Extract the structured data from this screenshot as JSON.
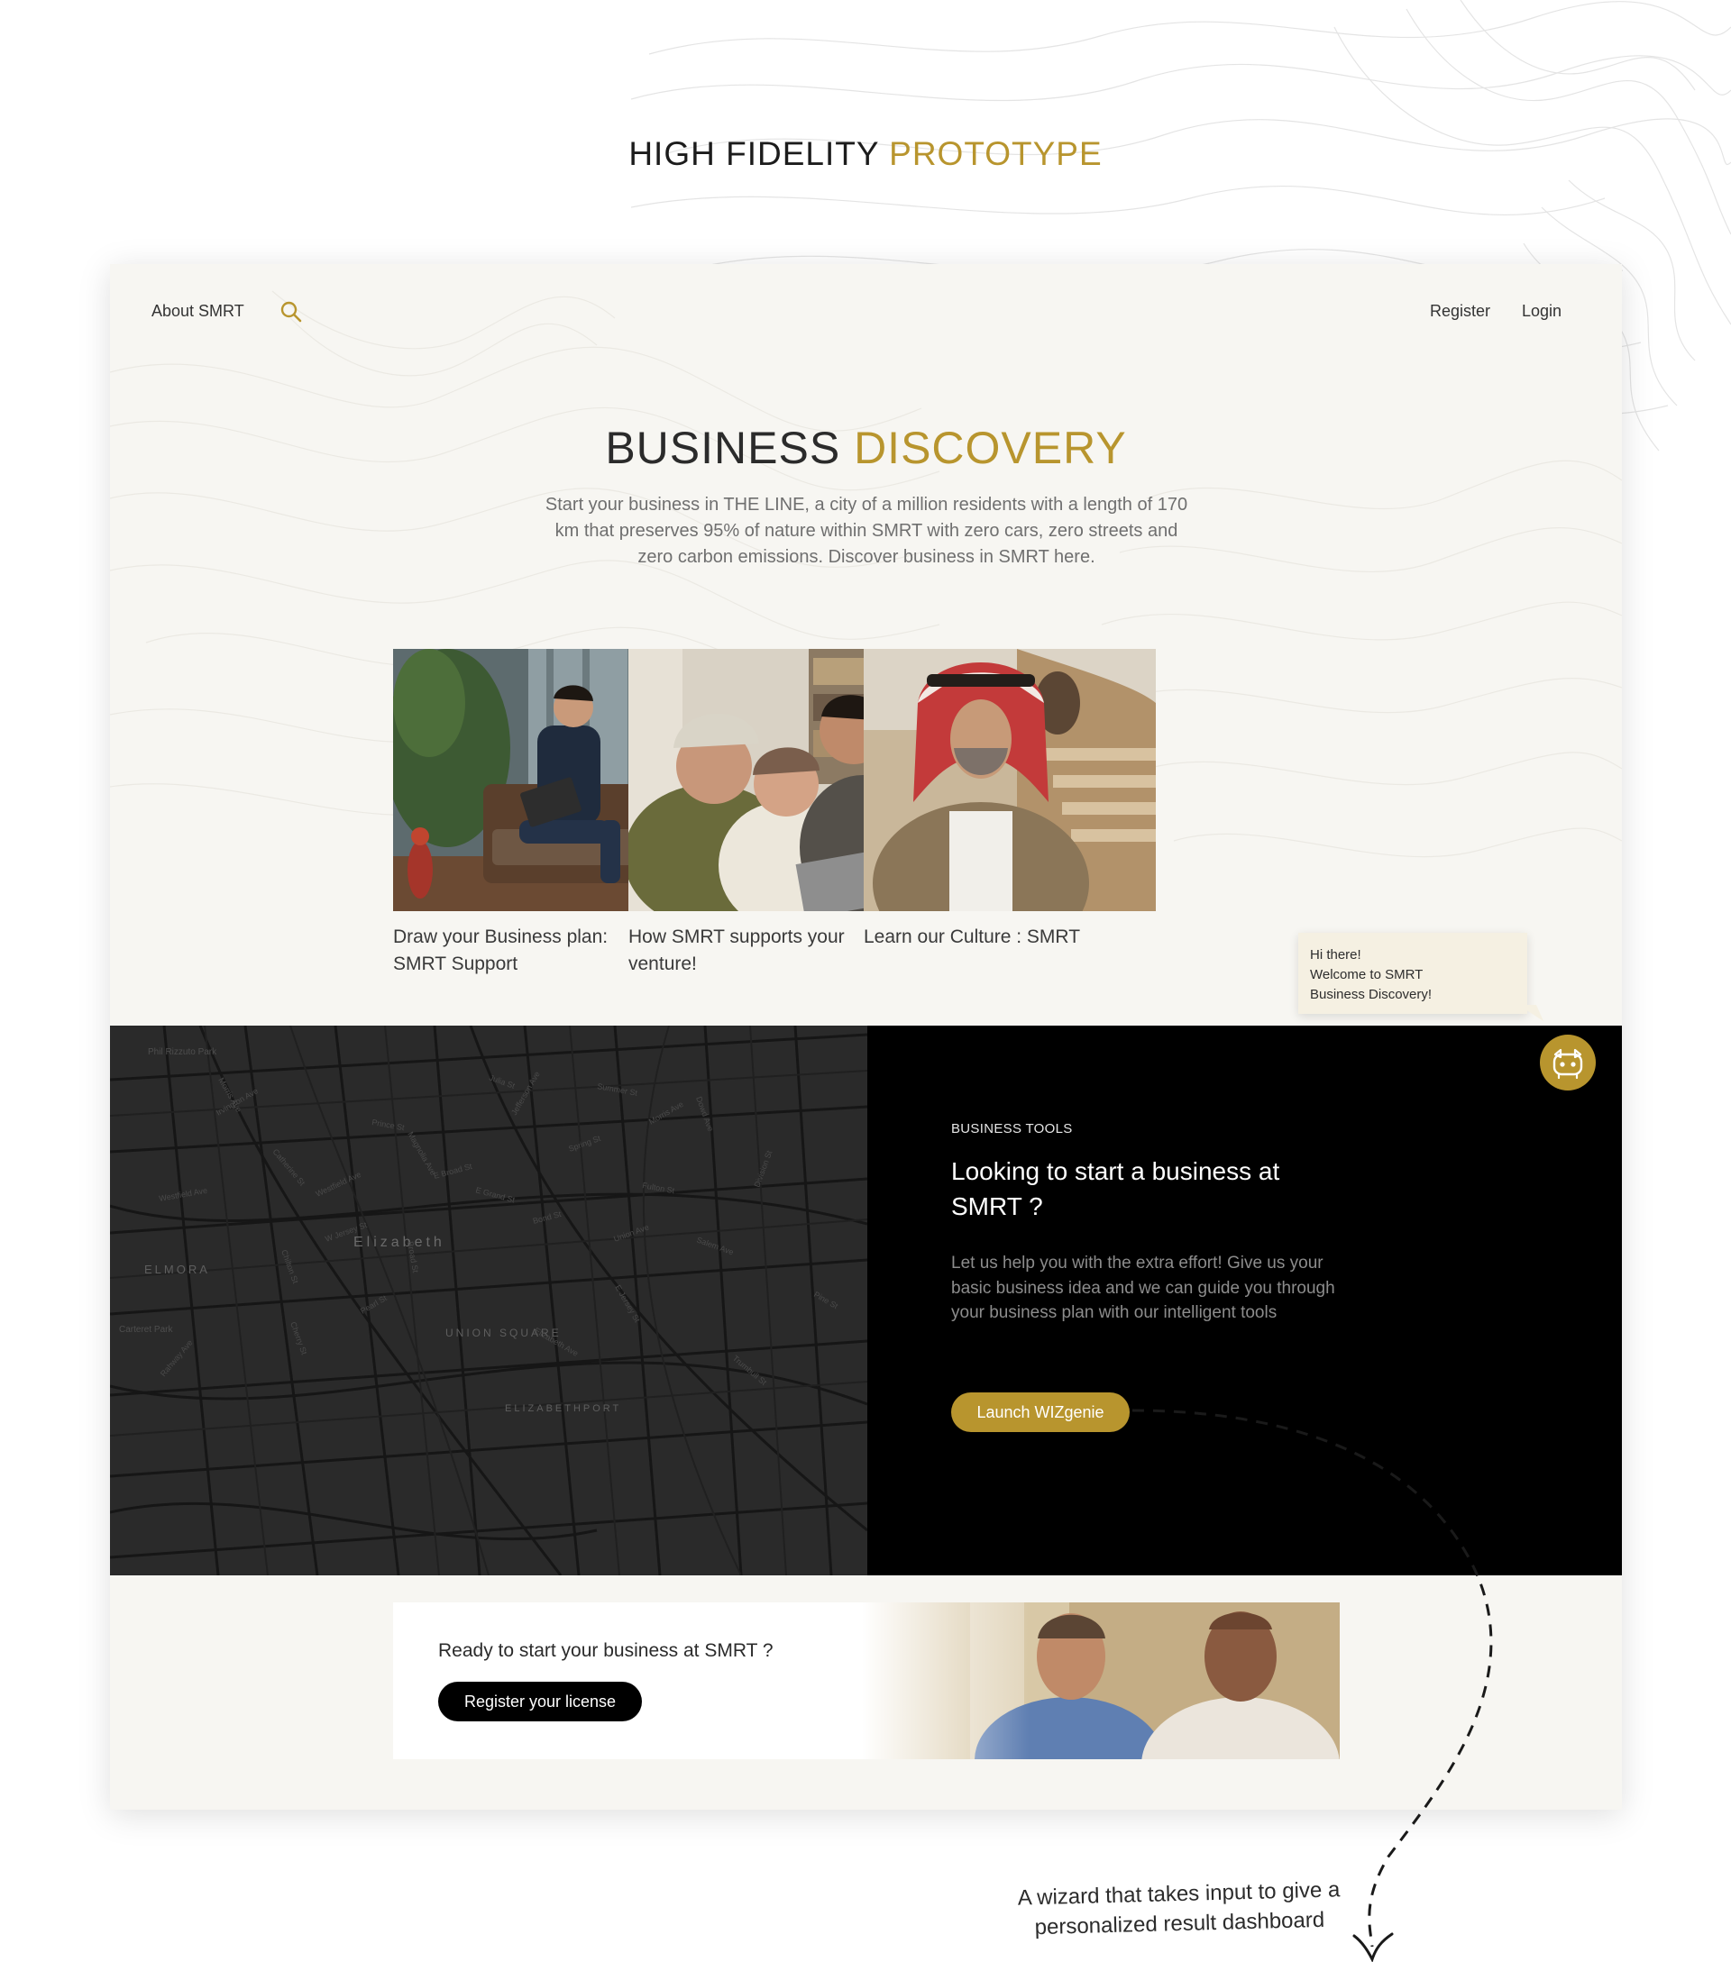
{
  "page": {
    "title_part1": "HIGH FIDELITY",
    "title_part2": "PROTOTYPE",
    "annotation": "A wizard that takes input to give a\npersonalized result dashboard"
  },
  "nav": {
    "about": "About  SMRT",
    "register": "Register",
    "login": "Login"
  },
  "hero": {
    "title_part1": "BUSINESS",
    "title_part2": "DISCOVERY",
    "description": "Start your business in THE LINE, a city of a million residents with a length of 170 km that preserves 95% of nature within  SMRT  with zero cars, zero streets and zero carbon emissions. Discover business in  SMRT  here."
  },
  "cards": [
    {
      "caption": "Draw your Business plan:\n SMRT  Support",
      "image": "man-with-laptop-photo"
    },
    {
      "caption": "How  SMRT  supports your venture!",
      "image": "team-laughing-photo"
    },
    {
      "caption": "Learn our Culture : SMRT",
      "image": "man-in-shemagh-photo"
    }
  ],
  "chat_bubble": {
    "text": "Hi there!\nWelcome to SMRT\nBusiness Discovery!"
  },
  "map": {
    "labels": [
      "Elizabeth",
      "ELMORA",
      "UNION SQUARE",
      "ELIZABETHPORT",
      "Phil Rizzuto Park",
      "Carteret Park",
      "Westfield Ave",
      "E Grand St",
      "W Jersey St",
      "Broad St",
      "Trumbull St",
      "Rahway Ave",
      "Morris Ave",
      "Elizabeth Ave",
      "Dowd Ave",
      "Pearl St",
      "E Jersey St",
      "Prince St",
      "Magnolia Ave",
      "Spring St",
      "Fulton St",
      "Chilton St",
      "Bond St",
      "Jefferson Ave",
      "Julia St",
      "Westfield Ave",
      "Division St",
      "Pine St",
      "E Broad St",
      "Union Ave",
      "Catherine St",
      "Morris Ave",
      "Cherry St",
      "Irvington Ave",
      "Salem Ave",
      "Summer St"
    ]
  },
  "tools": {
    "eyebrow": "BUSINESS TOOLS",
    "title": "Looking to start a business at  SMRT  ?",
    "description": "Let us help you with the extra effort! Give us your basic business idea and we can guide you through your business plan with our intelligent tools",
    "button": "Launch WIZgenie"
  },
  "banner": {
    "text": "Ready to start your business at  SMRT ?",
    "button": "Register your license",
    "image": "two-men-smiling-photo"
  },
  "colors": {
    "accent": "#b8952e",
    "page_bg": "#f7f6f2",
    "dark": "#000000",
    "map": "#2a2a2a"
  },
  "icons": [
    "search-icon",
    "genie-bot-icon",
    "arrow-down-icon"
  ]
}
